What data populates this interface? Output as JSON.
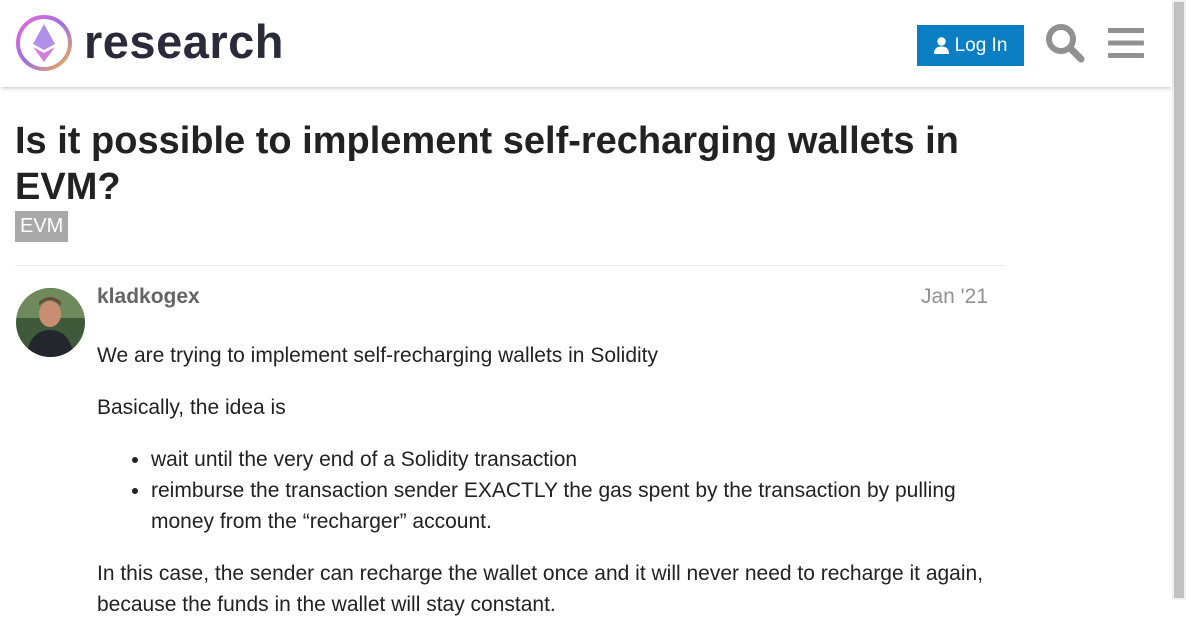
{
  "header": {
    "site_name": "research",
    "login_label": "Log In"
  },
  "topic": {
    "title": "Is it possible to implement self-recharging wallets in EVM?",
    "tag": "EVM"
  },
  "post": {
    "username": "kladkogex",
    "date": "Jan '21",
    "paragraphs": [
      "We are trying to implement self-recharging wallets in Solidity",
      "Basically, the idea is"
    ],
    "bullets": [
      "wait until the very end of a Solidity transaction",
      "reimburse the transaction sender EXACTLY the gas spent by the transaction by pulling money from the “recharger” account."
    ],
    "closing": "In this case, the sender can recharge the wallet once and it will never need to recharge it again, because the funds in the wallet will stay constant."
  },
  "colors": {
    "accent": "#0a7ec2",
    "tag_bg": "#a9a9a9"
  }
}
